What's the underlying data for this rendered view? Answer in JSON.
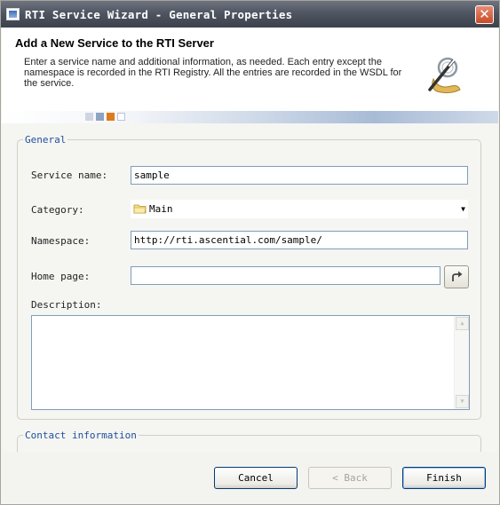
{
  "window": {
    "title": "RTI Service Wizard - General Properties",
    "close_glyph": "✕"
  },
  "header": {
    "title": "Add a New Service to the RTI Server",
    "description": "Enter a service name and additional information, as needed. Each entry except the namespace is recorded in the RTI Registry. All the entries are recorded in the WSDL for the service.",
    "icon": "wizard-wand-icon"
  },
  "general": {
    "legend": "General",
    "service_name_label": "Service name:",
    "service_name_value": "sample",
    "category_label": "Category:",
    "category_value": "Main",
    "namespace_label": "Namespace:",
    "namespace_value": "http://rti.ascential.com/sample/",
    "home_page_label": "Home page:",
    "home_page_value": "",
    "description_label": "Description:",
    "description_value": ""
  },
  "contact": {
    "legend": "Contact information"
  },
  "footer": {
    "cancel_label": "Cancel",
    "back_label": "< Back",
    "finish_label": "Finish"
  },
  "colors": {
    "accent": "#1f4f9a",
    "title_bar": "#4f5561",
    "close_button": "#c94a26"
  }
}
